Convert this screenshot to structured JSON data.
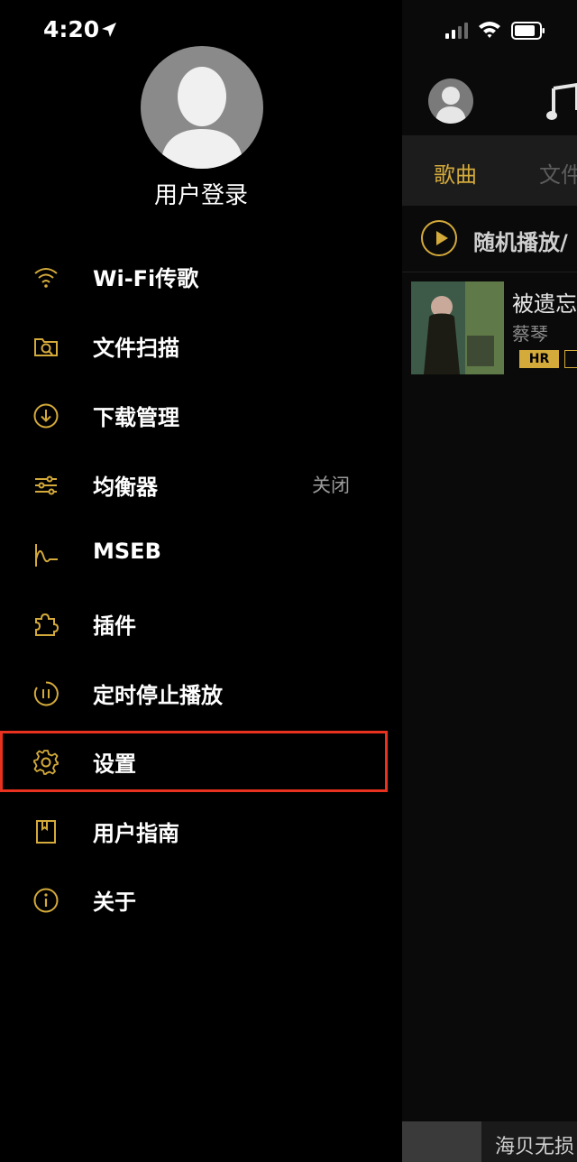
{
  "status_bar": {
    "time": "4:20"
  },
  "drawer": {
    "login_label": "用户登录",
    "menu": [
      {
        "label": "Wi-Fi传歌",
        "icon": "wifi-icon"
      },
      {
        "label": "文件扫描",
        "icon": "folder-search-icon"
      },
      {
        "label": "下载管理",
        "icon": "download-icon"
      },
      {
        "label": "均衡器",
        "icon": "equalizer-icon",
        "value": "关闭"
      },
      {
        "label": "MSEB",
        "icon": "mseb-wave-icon"
      },
      {
        "label": "插件",
        "icon": "puzzle-icon"
      },
      {
        "label": "定时停止播放",
        "icon": "timer-pause-icon"
      },
      {
        "label": "设置",
        "icon": "gear-icon",
        "highlighted": true
      },
      {
        "label": "用户指南",
        "icon": "book-icon"
      },
      {
        "label": "关于",
        "icon": "info-icon"
      }
    ]
  },
  "background": {
    "tabs": [
      {
        "label": "歌曲",
        "active": true
      },
      {
        "label": "文件",
        "active": false
      }
    ],
    "shuffle_label": "随机播放/",
    "song": {
      "title": "被遗忘",
      "artist": "蔡琴",
      "badge": "HR"
    },
    "mini_player_title": "海贝无损"
  },
  "colors": {
    "accent": "#d4aa3b",
    "highlight_border": "#e8321f",
    "background": "#000000"
  }
}
